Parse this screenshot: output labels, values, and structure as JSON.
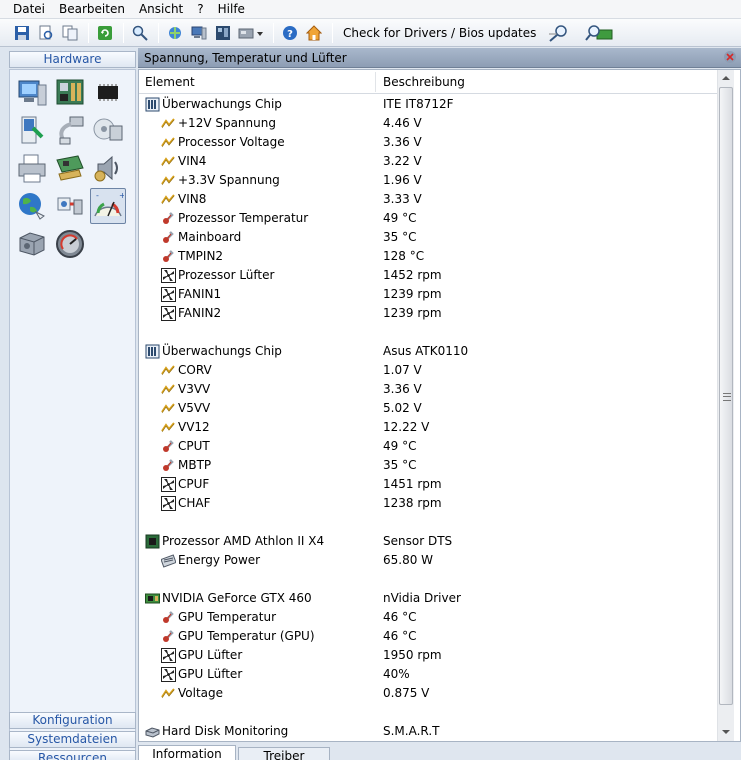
{
  "menu": [
    "Datei",
    "Bearbeiten",
    "Ansicht",
    "?",
    "Hilfe"
  ],
  "toolbar": {
    "drivers_label": "Check for Drivers / Bios updates"
  },
  "left": {
    "hardware_label": "Hardware",
    "konfiguration_label": "Konfiguration",
    "systemdateien_label": "Systemdateien",
    "ressourcen_label": "Ressourcen"
  },
  "panel_title": "Spannung, Temperatur und Lüfter",
  "columns": {
    "element": "Element",
    "beschreibung": "Beschreibung"
  },
  "rows": [
    {
      "name": "Überwachungs Chip",
      "value": "ITE IT8712F",
      "icon": "chip-icon",
      "level": 0
    },
    {
      "name": "+12V Spannung",
      "value": "4.46 V",
      "icon": "voltage-icon",
      "level": 1
    },
    {
      "name": "Processor Voltage",
      "value": "3.36 V",
      "icon": "voltage-icon",
      "level": 1
    },
    {
      "name": "VIN4",
      "value": "3.22 V",
      "icon": "voltage-icon",
      "level": 1
    },
    {
      "name": "+3.3V Spannung",
      "value": "1.96 V",
      "icon": "voltage-icon",
      "level": 1
    },
    {
      "name": "VIN8",
      "value": "3.33 V",
      "icon": "voltage-icon",
      "level": 1
    },
    {
      "name": "Prozessor Temperatur",
      "value": "49 °C",
      "icon": "thermometer-icon",
      "level": 1
    },
    {
      "name": "Mainboard",
      "value": "35 °C",
      "icon": "thermometer-icon",
      "level": 1
    },
    {
      "name": "TMPIN2",
      "value": "128 °C",
      "icon": "thermometer-icon",
      "level": 1
    },
    {
      "name": "Prozessor Lüfter",
      "value": "1452 rpm",
      "icon": "fan-icon",
      "level": 1
    },
    {
      "name": "FANIN1",
      "value": "1239 rpm",
      "icon": "fan-icon",
      "level": 1
    },
    {
      "name": "FANIN2",
      "value": "1239 rpm",
      "icon": "fan-icon",
      "level": 1
    },
    {
      "name": "",
      "value": "",
      "icon": "",
      "level": 0
    },
    {
      "name": "Überwachungs Chip",
      "value": "Asus ATK0110",
      "icon": "chip-icon",
      "level": 0
    },
    {
      "name": "CORV",
      "value": "1.07 V",
      "icon": "voltage-icon",
      "level": 1
    },
    {
      "name": "V3VV",
      "value": "3.36 V",
      "icon": "voltage-icon",
      "level": 1
    },
    {
      "name": "V5VV",
      "value": "5.02 V",
      "icon": "voltage-icon",
      "level": 1
    },
    {
      "name": "VV12",
      "value": "12.22 V",
      "icon": "voltage-icon",
      "level": 1
    },
    {
      "name": "CPUT",
      "value": "49 °C",
      "icon": "thermometer-icon",
      "level": 1
    },
    {
      "name": "MBTP",
      "value": "35 °C",
      "icon": "thermometer-icon",
      "level": 1
    },
    {
      "name": "CPUF",
      "value": "1451 rpm",
      "icon": "fan-icon",
      "level": 1
    },
    {
      "name": "CHAF",
      "value": "1238 rpm",
      "icon": "fan-icon",
      "level": 1
    },
    {
      "name": "",
      "value": "",
      "icon": "",
      "level": 0
    },
    {
      "name": "Prozessor AMD Athlon II X4",
      "value": "Sensor DTS",
      "icon": "cpu-icon",
      "level": 0
    },
    {
      "name": "Energy Power",
      "value": "65.80 W",
      "icon": "power-icon",
      "level": 1
    },
    {
      "name": "",
      "value": "",
      "icon": "",
      "level": 0
    },
    {
      "name": "NVIDIA GeForce GTX 460",
      "value": "nVidia Driver",
      "icon": "gpu-icon",
      "level": 0
    },
    {
      "name": "GPU Temperatur",
      "value": "46 °C",
      "icon": "thermometer-icon",
      "level": 1
    },
    {
      "name": "GPU Temperatur (GPU)",
      "value": "46 °C",
      "icon": "thermometer-icon",
      "level": 1
    },
    {
      "name": "GPU Lüfter",
      "value": "1950 rpm",
      "icon": "fan-icon",
      "level": 1
    },
    {
      "name": "GPU Lüfter",
      "value": "40%",
      "icon": "fan-icon",
      "level": 1
    },
    {
      "name": "Voltage",
      "value": "0.875 V",
      "icon": "voltage-icon",
      "level": 1
    },
    {
      "name": "",
      "value": "",
      "icon": "",
      "level": 0
    },
    {
      "name": "Hard Disk Monitoring",
      "value": "S.M.A.R.T",
      "icon": "harddisk-icon",
      "level": 0
    }
  ],
  "bottom_tabs": [
    "Information",
    "Treiber"
  ],
  "colors": {
    "title_bar": "#9aa9bf",
    "accent_blue": "#2757a6",
    "voltage": "#d9a21b",
    "thermometer": "#c0392b"
  }
}
